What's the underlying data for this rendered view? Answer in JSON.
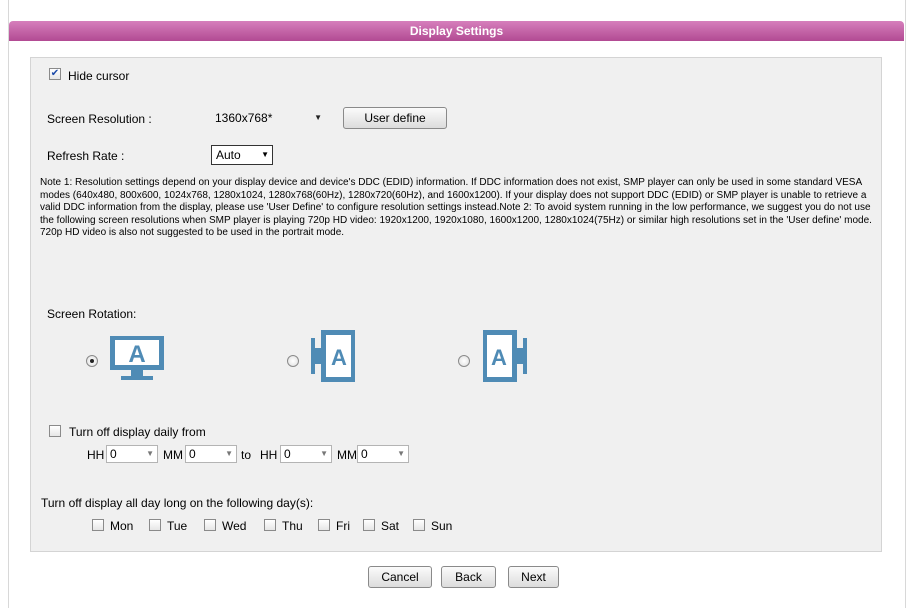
{
  "header": {
    "title": "Display Settings"
  },
  "hide_cursor": {
    "label": "Hide cursor",
    "checked": true
  },
  "resolution": {
    "label": "Screen Resolution :",
    "value": "1360x768*",
    "user_define_label": "User define"
  },
  "refresh": {
    "label": "Refresh Rate :",
    "value": "Auto"
  },
  "note": "Note 1: Resolution settings depend on your display device and device's DDC (EDID) information. If DDC information does not exist, SMP player can only be used in some standard VESA modes (640x480, 800x600, 1024x768, 1280x1024, 1280x768(60Hz), 1280x720(60Hz), and 1600x1200). If your display does not support DDC (EDID) or SMP player is unable to retrieve a valid DDC information from the display, please use 'User Define' to configure resolution settings instead.Note 2: To avoid system running in the low performance, we suggest you do not use the following screen resolutions when SMP player is playing 720p HD video: 1920x1200, 1920x1080, 1600x1200, 1280x1024(75Hz) or similar high resolutions set in the 'User define' mode. 720p HD video is also not suggested to be used in the portrait mode.",
  "rotation": {
    "label": "Screen Rotation:",
    "options": [
      {
        "icon": "landscape-monitor-icon",
        "selected": true
      },
      {
        "icon": "portrait-left-monitor-icon",
        "selected": false
      },
      {
        "icon": "portrait-right-monitor-icon",
        "selected": false
      }
    ]
  },
  "daily_off": {
    "label": "Turn off display daily from",
    "checked": false,
    "hh_label": "HH",
    "mm_label": "MM",
    "to_label": "to",
    "from_hh": "0",
    "from_mm": "0",
    "to_hh": "0",
    "to_mm": "0"
  },
  "days": {
    "label": "Turn off display all day long on the following day(s):",
    "items": [
      "Mon",
      "Tue",
      "Wed",
      "Thu",
      "Fri",
      "Sat",
      "Sun"
    ]
  },
  "footer": {
    "cancel": "Cancel",
    "back": "Back",
    "next": "Next"
  },
  "colors": {
    "header_start": "#d67fbc",
    "header_end": "#b24a93",
    "icon_blue": "#4f8bb5"
  }
}
